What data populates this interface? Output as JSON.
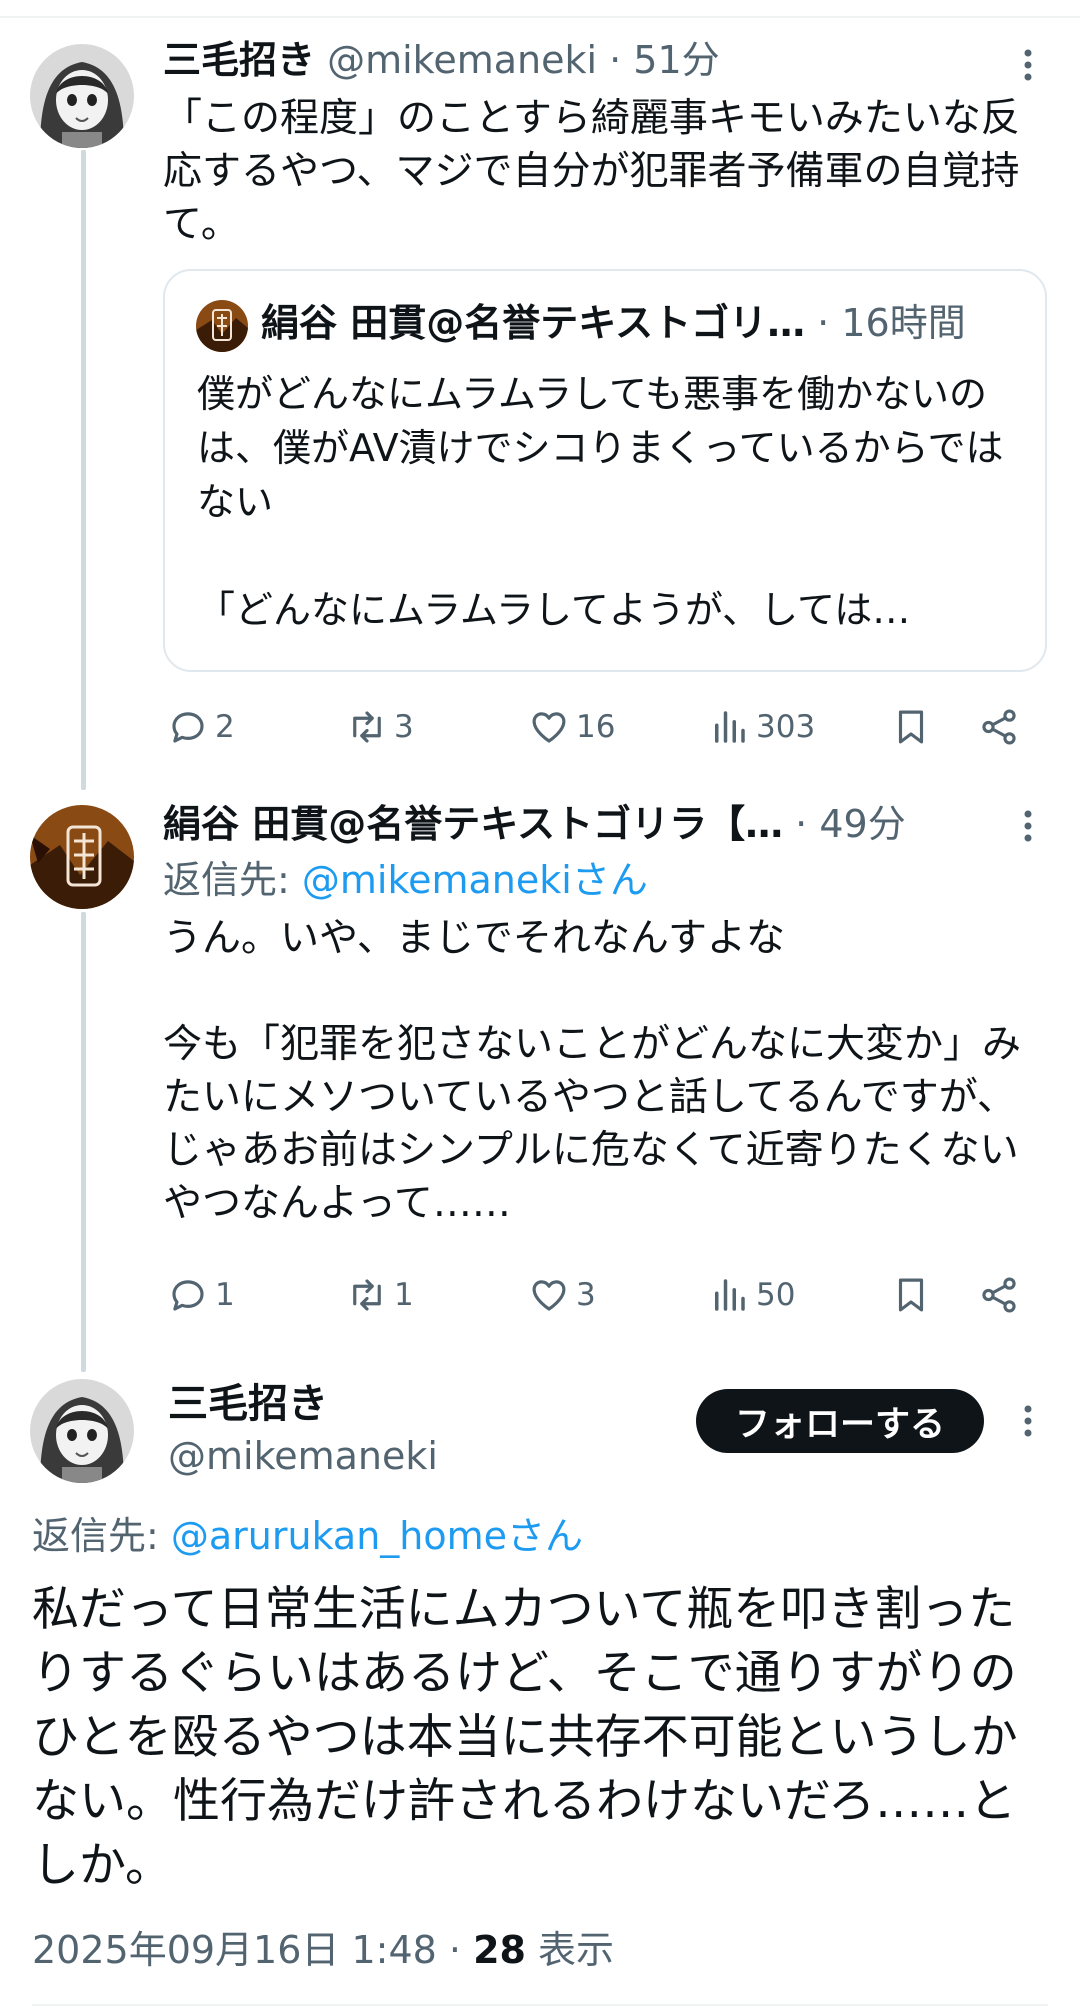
{
  "tweet1": {
    "name": "三毛招き",
    "handle": "@mikemaneki",
    "sep": " · ",
    "time": "51分",
    "text": "「この程度」のことすら綺麗事キモいみたいな反応するやつ、マジで自分が犯罪者予備軍の自覚持て。",
    "quote": {
      "name": "絹谷 田貫@名誉テキストゴリ…",
      "sep": " · ",
      "time": "16時間",
      "text": "僕がどんなにムラムラしても悪事を働かないのは、僕がAV漬けでシコりまくっているからではない\n\n「どんなにムラムラしてようが、しては…"
    },
    "actions": {
      "replies": "2",
      "retweets": "3",
      "likes": "16",
      "views": "303"
    }
  },
  "tweet2": {
    "name": "絹谷 田貫@名誉テキストゴリラ【…",
    "sep": " · ",
    "time": "49分",
    "reply_prefix": "返信先: ",
    "reply_to": "@mikemanekiさん",
    "text": "うん。いや、まじでそれなんすよな\n\n今も「犯罪を犯さないことがどんなに大変か」みたいにメソついているやつと話してるんですが、じゃあお前はシンプルに危なくて近寄りたくないやつなんよって……",
    "actions": {
      "replies": "1",
      "retweets": "1",
      "likes": "3",
      "views": "50"
    }
  },
  "main": {
    "name": "三毛招き",
    "handle": "@mikemaneki",
    "follow_label": "フォローする",
    "reply_prefix": "返信先: ",
    "reply_to": "@arurukan_homeさん",
    "text": "私だって日常生活にムカついて瓶を叩き割ったりするぐらいはあるけど、そこで通りすがりのひとを殴るやつは本当に共存不可能というしかない。性行為だけ許されるわけないだろ……としか。",
    "date": "2025年09月16日 1:48",
    "sep": " · ",
    "views": "28",
    "views_label": " 表示"
  },
  "colors": {
    "link": "#1d9bf0",
    "muted": "#536471",
    "text": "#0f1419",
    "thread_line": "#cfd9de"
  },
  "icons": [
    "reply-icon",
    "retweet-icon",
    "like-icon",
    "views-icon",
    "bookmark-icon",
    "share-icon",
    "more-icon"
  ]
}
